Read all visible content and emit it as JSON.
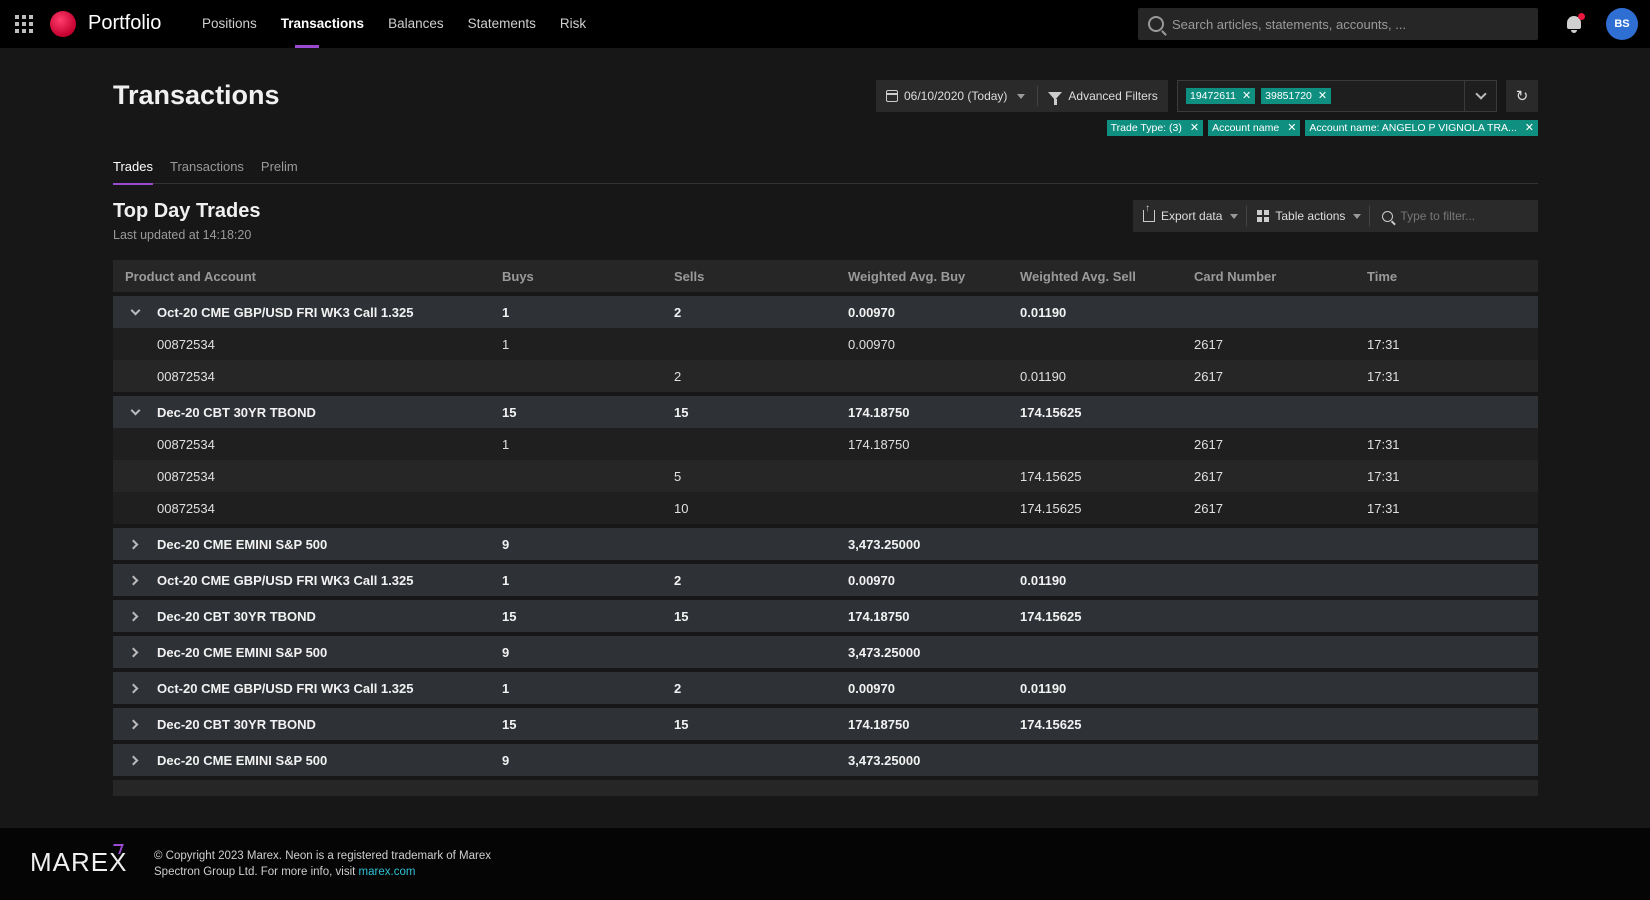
{
  "app": {
    "brand": "Portfolio",
    "nav": [
      "Positions",
      "Transactions",
      "Balances",
      "Statements",
      "Risk"
    ],
    "active_nav": "Transactions",
    "search_placeholder": "Search articles, statements, accounts, ...",
    "avatar_initials": "BS",
    "accent_color": "#9b4bd1",
    "chip_color": "#0f8f7f"
  },
  "header": {
    "title": "Transactions",
    "date_label": "06/10/2020 (Today)",
    "advanced_filters_label": "Advanced Filters",
    "account_chips": [
      "19472611",
      "39851720"
    ],
    "filter_tags": [
      "Trade Type: (3)",
      "Account name",
      "Account name: ANGELO P VIGNOLA TRA..."
    ]
  },
  "tabs": [
    "Trades",
    "Transactions",
    "Prelim"
  ],
  "section": {
    "title": "Top Day Trades",
    "subtitle": "Last updated at 14:18:20",
    "export_label": "Export data",
    "table_actions_label": "Table actions",
    "filter_placeholder": "Type to filter..."
  },
  "table": {
    "columns": [
      "Product and Account",
      "Buys",
      "Sells",
      "Weighted Avg. Buy",
      "Weighted Avg. Sell",
      "Card Number",
      "Time"
    ],
    "groups": [
      {
        "product": "Oct-20 CME GBP/USD FRI WK3 Call 1.325",
        "buys": "1",
        "sells": "2",
        "wab": "0.00970",
        "was": "0.01190",
        "expanded": true,
        "children": [
          {
            "account": "00872534",
            "buys": "1",
            "sells": "",
            "wab": "0.00970",
            "was": "",
            "card": "2617",
            "time": "17:31"
          },
          {
            "account": "00872534",
            "buys": "",
            "sells": "2",
            "wab": "",
            "was": "0.01190",
            "card": "2617",
            "time": "17:31"
          }
        ]
      },
      {
        "product": "Dec-20 CBT 30YR TBOND",
        "buys": "15",
        "sells": "15",
        "wab": "174.18750",
        "was": "174.15625",
        "expanded": true,
        "children": [
          {
            "account": "00872534",
            "buys": "1",
            "sells": "",
            "wab": "174.18750",
            "was": "",
            "card": "2617",
            "time": "17:31"
          },
          {
            "account": "00872534",
            "buys": "",
            "sells": "5",
            "wab": "",
            "was": "174.15625",
            "card": "2617",
            "time": "17:31"
          },
          {
            "account": "00872534",
            "buys": "",
            "sells": "10",
            "wab": "",
            "was": "174.15625",
            "card": "2617",
            "time": "17:31"
          }
        ]
      },
      {
        "product": "Dec-20 CME EMINI S&P 500",
        "buys": "9",
        "sells": "",
        "wab": "3,473.25000",
        "was": "",
        "expanded": false,
        "children": []
      },
      {
        "product": "Oct-20 CME GBP/USD FRI WK3 Call 1.325",
        "buys": "1",
        "sells": "2",
        "wab": "0.00970",
        "was": "0.01190",
        "expanded": false,
        "children": []
      },
      {
        "product": "Dec-20 CBT 30YR TBOND",
        "buys": "15",
        "sells": "15",
        "wab": "174.18750",
        "was": "174.15625",
        "expanded": false,
        "children": []
      },
      {
        "product": "Dec-20 CME EMINI S&P 500",
        "buys": "9",
        "sells": "",
        "wab": "3,473.25000",
        "was": "",
        "expanded": false,
        "children": []
      },
      {
        "product": "Oct-20 CME GBP/USD FRI WK3 Call 1.325",
        "buys": "1",
        "sells": "2",
        "wab": "0.00970",
        "was": "0.01190",
        "expanded": false,
        "children": []
      },
      {
        "product": "Dec-20 CBT 30YR TBOND",
        "buys": "15",
        "sells": "15",
        "wab": "174.18750",
        "was": "174.15625",
        "expanded": false,
        "children": []
      },
      {
        "product": "Dec-20 CME EMINI S&P 500",
        "buys": "9",
        "sells": "",
        "wab": "3,473.25000",
        "was": "",
        "expanded": false,
        "children": []
      }
    ]
  },
  "footer": {
    "logo_text": "MAREX",
    "copyright": "© Copyright 2023 Marex. Neon is a registered trademark of Marex Spectron Group Ltd. For more info, visit",
    "link_text": "marex.com"
  }
}
